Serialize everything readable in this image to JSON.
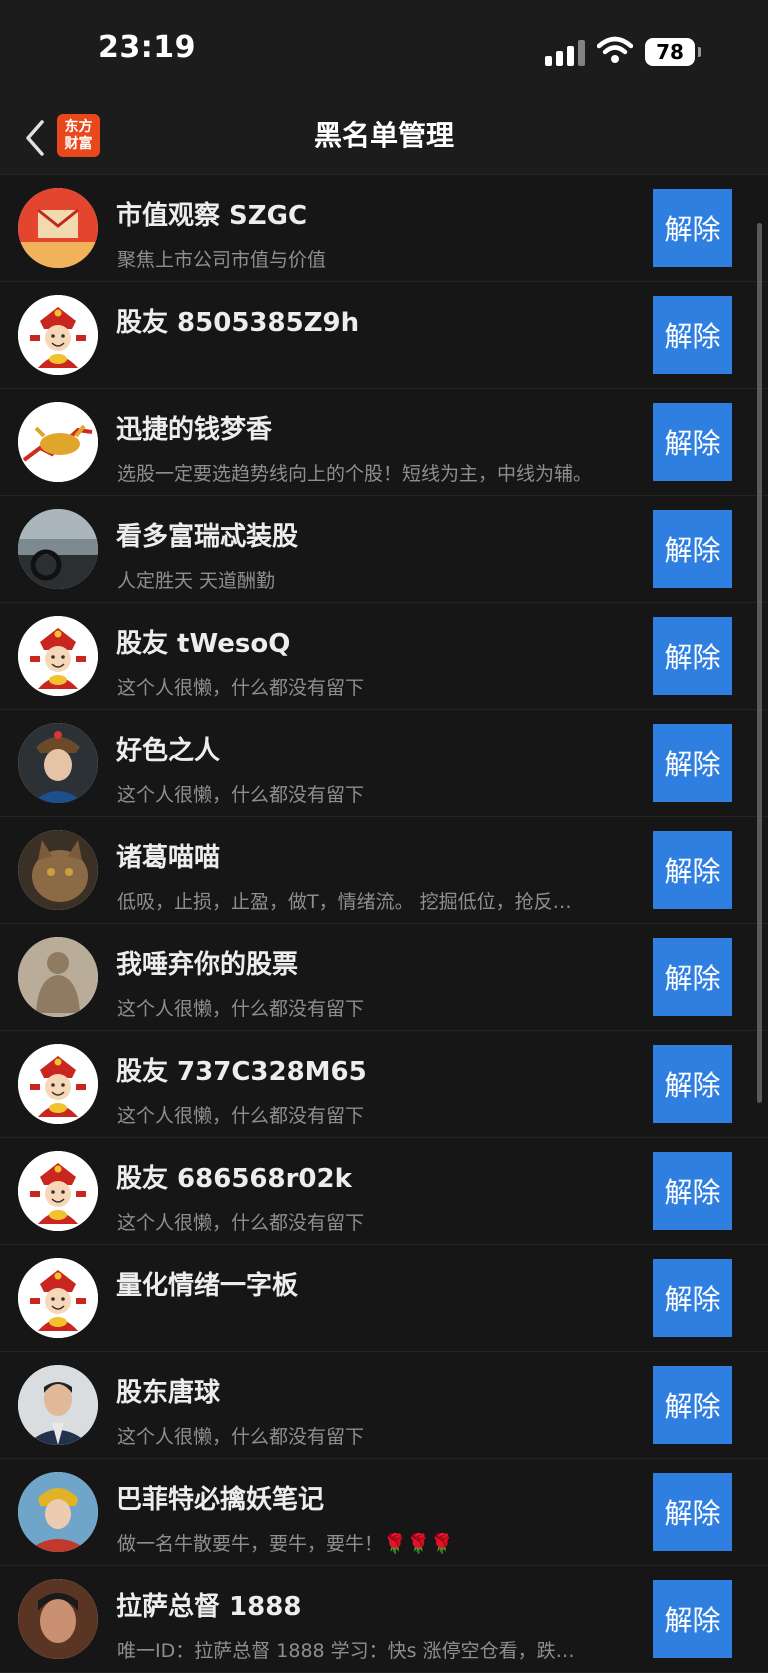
{
  "status": {
    "time": "23:19",
    "battery": "78"
  },
  "nav": {
    "title": "黑名单管理",
    "logo_line1": "东方",
    "logo_line2": "财富"
  },
  "action_label": "解除",
  "colors": {
    "accent": "#2f7fe0",
    "brand": "#e8481b",
    "background": "#161616"
  },
  "users": [
    {
      "name": "市值观察 SZGC",
      "bio": "聚焦上市公司市值与价值",
      "avatar": "red-envelope-logo"
    },
    {
      "name": "股友 8505385Z9h",
      "bio": "",
      "avatar": "god-of-wealth-default"
    },
    {
      "name": "迅捷的钱梦香",
      "bio": "选股一定要选趋势线向上的个股！短线为主，中线为辅。",
      "avatar": "golden-bull"
    },
    {
      "name": "看多富瑞忒装股",
      "bio": "人定胜天 天道酬勤",
      "avatar": "car-interior-photo"
    },
    {
      "name": "股友 tWesoQ",
      "bio": "这个人很懒，什么都没有留下",
      "avatar": "god-of-wealth-default"
    },
    {
      "name": "好色之人",
      "bio": "这个人很懒，什么都没有留下",
      "avatar": "qing-official-portrait"
    },
    {
      "name": "诸葛喵喵",
      "bio": "低吸，止损，止盈，做T，情绪流。 挖掘低位，抢反…",
      "avatar": "cat-photo"
    },
    {
      "name": "我唾弃你的股票",
      "bio": "这个人很懒，什么都没有留下",
      "avatar": "buddha-statue"
    },
    {
      "name": "股友 737C328M65",
      "bio": "这个人很懒，什么都没有留下",
      "avatar": "god-of-wealth-default"
    },
    {
      "name": "股友 686568r02k",
      "bio": "这个人很懒，什么都没有留下",
      "avatar": "god-of-wealth-default"
    },
    {
      "name": "量化情绪一字板",
      "bio": "",
      "avatar": "god-of-wealth-default"
    },
    {
      "name": "股东唐球",
      "bio": "这个人很懒，什么都没有留下",
      "avatar": "man-in-suit-portrait"
    },
    {
      "name": "巴菲特必擒妖笔记",
      "bio": "做一名牛散要牛，要牛，要牛！🌹🌹🌹",
      "avatar": "monk-costume-portrait"
    },
    {
      "name": "拉萨总督 1888",
      "bio": "唯一ID：拉萨总督 1888 学习：快s 涨停空仓看，跌…",
      "avatar": "actor-portrait"
    }
  ]
}
